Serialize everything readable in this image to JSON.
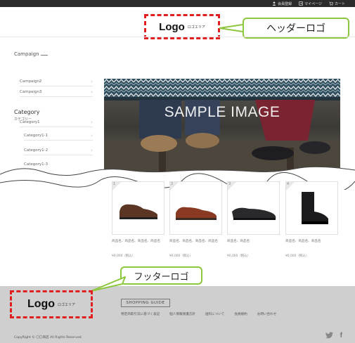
{
  "top_links": {
    "member": "会員登録",
    "mypage": "マイページ",
    "cart": "カート"
  },
  "header": {
    "logo": "Logo",
    "logo_sub": "ロゴエリア",
    "callout": "ヘッダーロゴ"
  },
  "sidebar": {
    "campaign_title": "Campaign",
    "campaign_items": [
      "Campaign2",
      "Campaign3"
    ],
    "category_title": "Category",
    "category_sub": "カテゴリー",
    "category_items": [
      "Category1",
      "Category1-1",
      "Category1-2",
      "Category1-3"
    ]
  },
  "hero": {
    "text": "SAMPLE IMAGE"
  },
  "products": [
    {
      "rank": "1",
      "name": "商品名、商品名、商品名、商品名",
      "price": "¥0,000（税込）"
    },
    {
      "rank": "2",
      "name": "商品名、商品名、商品名、商品名",
      "price": "¥0,000（税込）"
    },
    {
      "rank": "3",
      "name": "商品名、商品名",
      "price": "¥0,000（税込）"
    },
    {
      "rank": "4",
      "name": "商品名、商品名、商品名",
      "price": "¥0,000（税込）"
    }
  ],
  "footer": {
    "logo": "Logo",
    "logo_sub": "ロゴエリア",
    "callout": "フッターロゴ",
    "guide": "SHOPPING GUIDE",
    "links": [
      "特定商取引法に基づく表記",
      "個人情報保護方針",
      "送料について",
      "会員規約",
      "お問い合わせ"
    ],
    "copyright": "CopyRight © 〇〇商店 All Rights Reserved.",
    "social": [
      "twitter-icon",
      "facebook-icon"
    ]
  },
  "colors": {
    "dashed_red": "#e02020",
    "callout_green": "#8dc63f",
    "footer_bg": "#cfcfcf",
    "topbar_bg": "#2b2b2b"
  }
}
